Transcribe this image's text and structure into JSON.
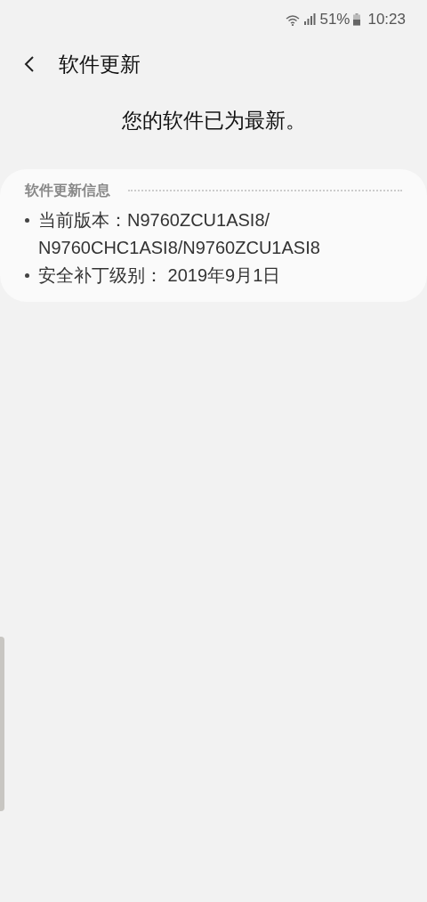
{
  "status_bar": {
    "battery": "51%",
    "time": "10:23"
  },
  "header": {
    "title": "软件更新"
  },
  "message": "您的软件已为最新。",
  "info_card": {
    "heading": "软件更新信息",
    "items": [
      {
        "lines": [
          "当前版本：N9760ZCU1ASI8/",
          "N9760CHC1ASI8/N9760ZCU1ASI8"
        ]
      },
      {
        "lines": [
          "安全补丁级别： 2019年9月1日"
        ]
      }
    ]
  }
}
